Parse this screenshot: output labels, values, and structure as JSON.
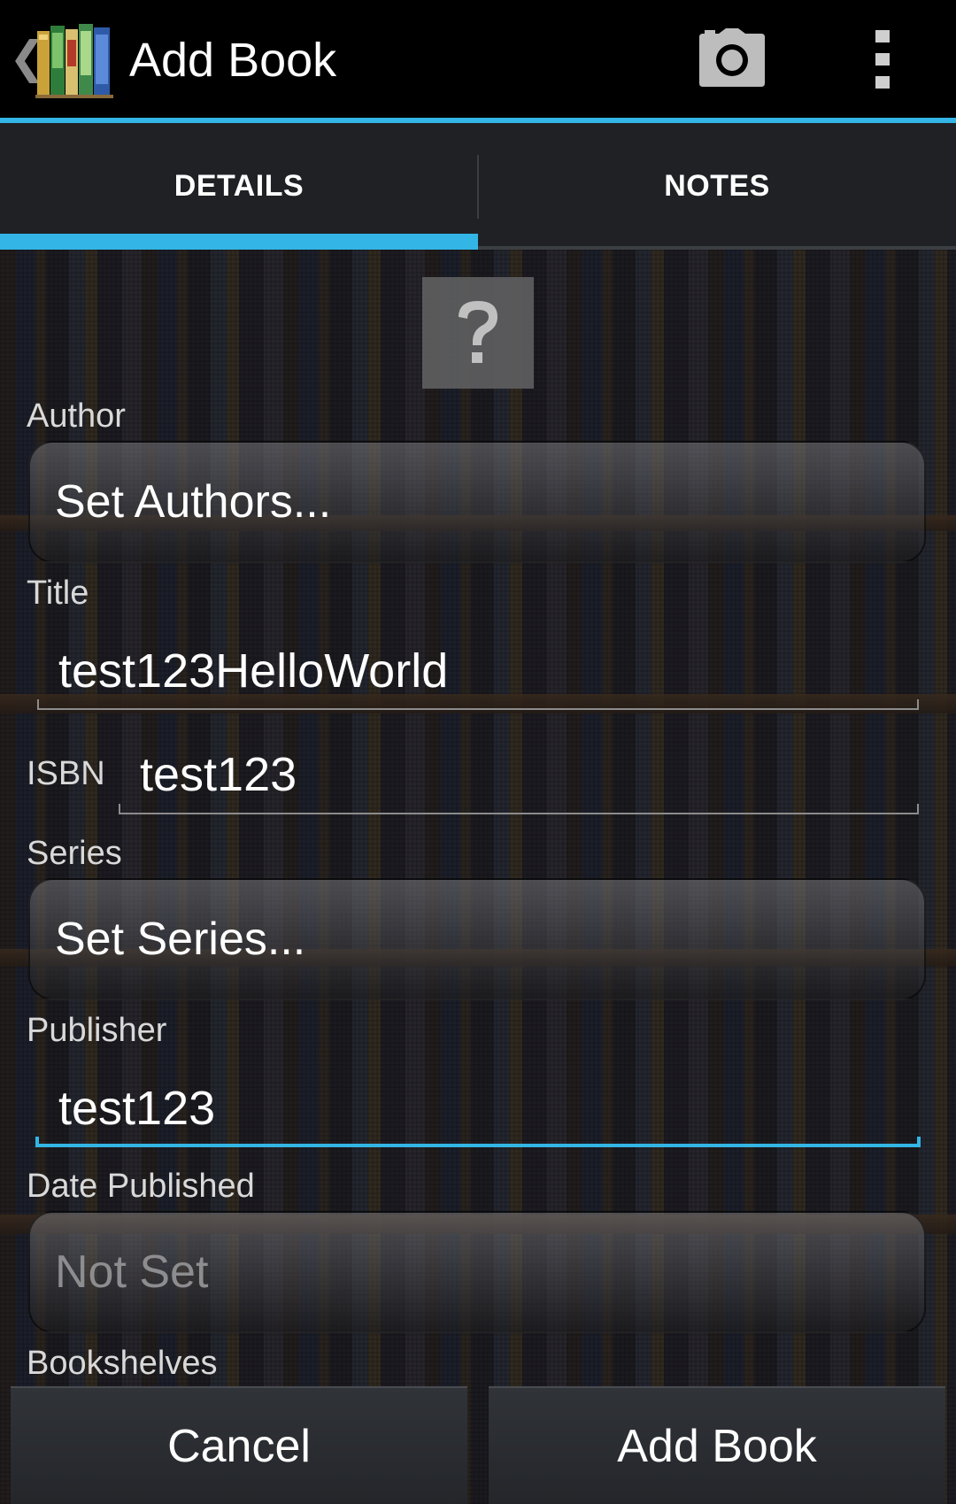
{
  "actionbar": {
    "title": "Add Book",
    "camera_icon": "camera-icon",
    "overflow_icon": "overflow-menu-icon"
  },
  "tabs": [
    {
      "label": "DETAILS",
      "selected": true
    },
    {
      "label": "NOTES",
      "selected": false
    }
  ],
  "colors": {
    "accent": "#33b5e5",
    "tabbar": "#1f2124",
    "actionbar": "#000000"
  },
  "form": {
    "cover_icon": "question-mark-icon",
    "author_label": "Author",
    "author_button": "Set Authors...",
    "title_label": "Title",
    "title_value": "test123HelloWorld",
    "isbn_label": "ISBN",
    "isbn_value": "test123",
    "series_label": "Series",
    "series_button": "Set Series...",
    "publisher_label": "Publisher",
    "publisher_value": "test123",
    "date_label": "Date Published",
    "date_button": "Not Set",
    "bookshelves_label": "Bookshelves"
  },
  "buttons": {
    "cancel": "Cancel",
    "add": "Add Book"
  }
}
